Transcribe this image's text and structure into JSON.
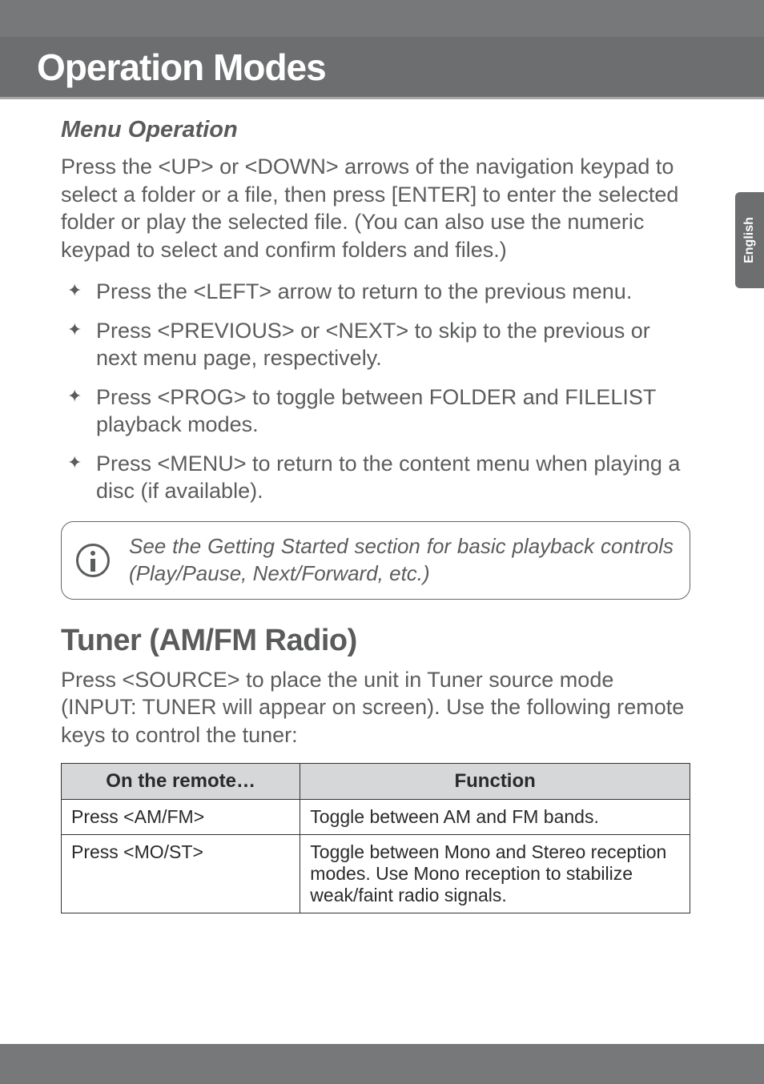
{
  "header": {
    "title": "Operation Modes"
  },
  "side_tab": "English",
  "section1": {
    "subhead": "Menu Operation",
    "intro": "Press the <UP> or <DOWN> arrows of the navigation keypad to select a folder or a file, then press [ENTER] to enter the selected folder or play the selected file. (You can also use the numeric keypad to select and confirm folders and files.)",
    "bullets": [
      "Press the <LEFT> arrow to return to the previous menu.",
      "Press <PREVIOUS> or <NEXT> to skip to the previous or next menu page, respectively.",
      "Press <PROG> to toggle between FOLDER and FILELIST playback modes.",
      "Press <MENU> to return to the content menu when playing a disc (if available)."
    ],
    "callout": "See the Getting Started section for basic playback controls (Play/Pause, Next/Forward, etc.)"
  },
  "section2": {
    "heading": "Tuner (AM/FM Radio)",
    "intro": "Press <SOURCE> to place the unit in Tuner source mode (INPUT: TUNER will appear on screen). Use the following remote keys to control the tuner:",
    "table": {
      "head": [
        "On the remote…",
        "Function"
      ],
      "rows": [
        [
          "Press <AM/FM>",
          "Toggle between AM and FM bands."
        ],
        [
          "Press <MO/ST>",
          "Toggle between Mono and Stereo reception modes. Use Mono reception to stabilize weak/faint radio signals."
        ]
      ]
    }
  }
}
